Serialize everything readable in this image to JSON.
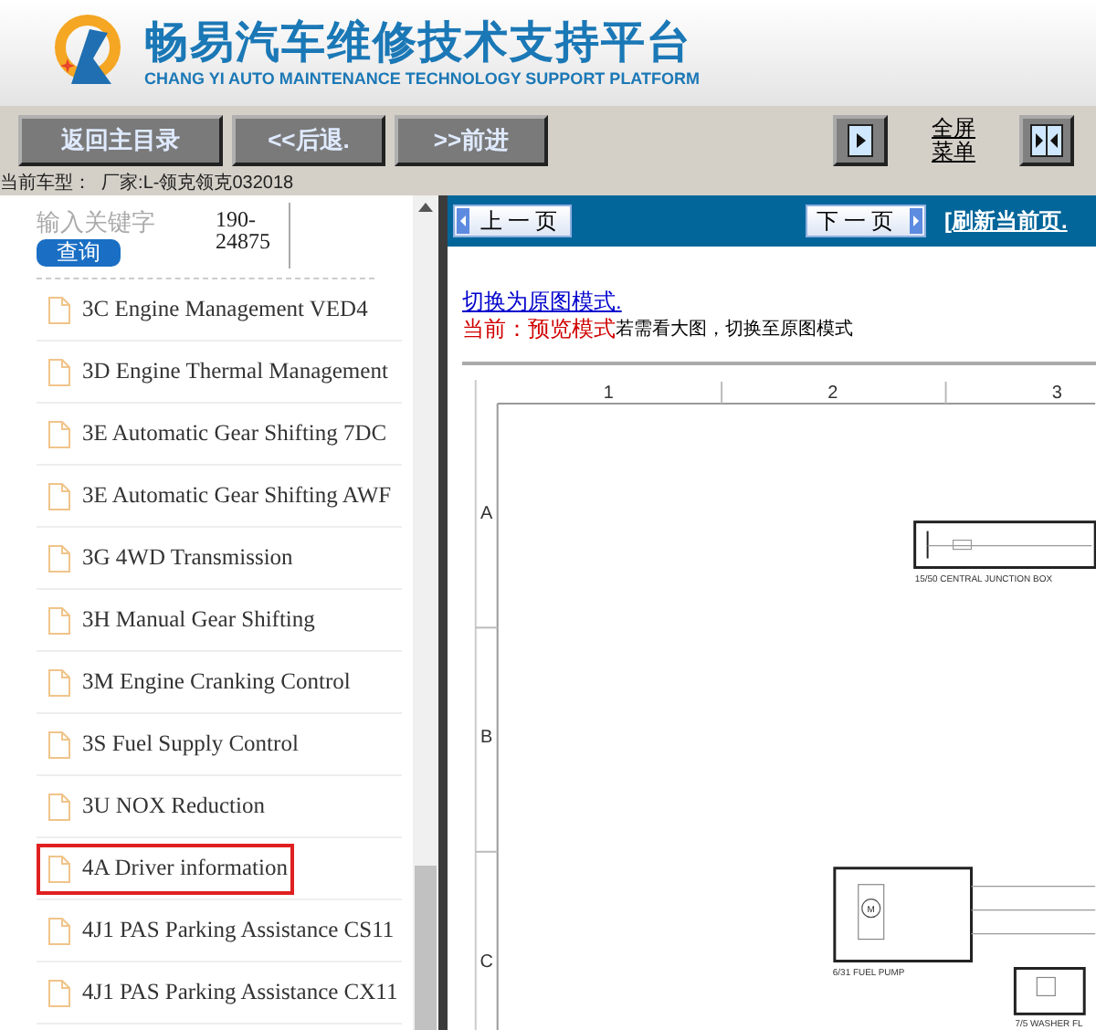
{
  "header": {
    "title": "畅易汽车维修技术支持平台",
    "subtitle": "CHANG YI AUTO MAINTENANCE TECHNOLOGY SUPPORT PLATFORM"
  },
  "toolbar": {
    "buttons": [
      "返回主目录",
      "<<后退.",
      ">>前进"
    ],
    "fullscreen_menu": "全屏菜单"
  },
  "vehicle_line": "当前车型：  厂家:L-领克领克032018",
  "search": {
    "placeholder": "输入关键字",
    "button": "查询",
    "code": "190-24875"
  },
  "items": [
    {
      "label": "3C Engine Management VED4",
      "selected": false
    },
    {
      "label": "3D Engine Thermal Management",
      "selected": false
    },
    {
      "label": "3E Automatic Gear Shifting 7DC",
      "selected": false
    },
    {
      "label": "3E Automatic Gear Shifting AWF",
      "selected": false
    },
    {
      "label": "3G 4WD Transmission",
      "selected": false
    },
    {
      "label": "3H Manual Gear Shifting",
      "selected": false
    },
    {
      "label": "3M Engine Cranking Control",
      "selected": false
    },
    {
      "label": "3S Fuel Supply Control",
      "selected": false
    },
    {
      "label": "3U NOX Reduction",
      "selected": false
    },
    {
      "label": "4A Driver information",
      "selected": true
    },
    {
      "label": "4J1 PAS Parking Assistance CS11",
      "selected": false
    },
    {
      "label": "4J1 PAS Parking Assistance CX11",
      "selected": false
    }
  ],
  "pager": {
    "prev": "上一页",
    "next": "下一页",
    "refresh": "[刷新当前页."
  },
  "mode_link": "切换为原图模式.",
  "mode_status": {
    "label": "当前：预览模式",
    "hint": "若需看大图，切换至原图模式"
  },
  "diagram": {
    "columns": [
      "1",
      "2",
      "3"
    ],
    "rows": [
      "A",
      "B",
      "C"
    ],
    "components": [
      {
        "kind": "junction_box",
        "label": "15/50 CENTRAL JUNCTION BOX"
      },
      {
        "kind": "motor",
        "label": "6/31 FUEL PUMP",
        "symbol": "M"
      },
      {
        "kind": "washer",
        "label": "7/5 WASHER FL"
      }
    ]
  }
}
